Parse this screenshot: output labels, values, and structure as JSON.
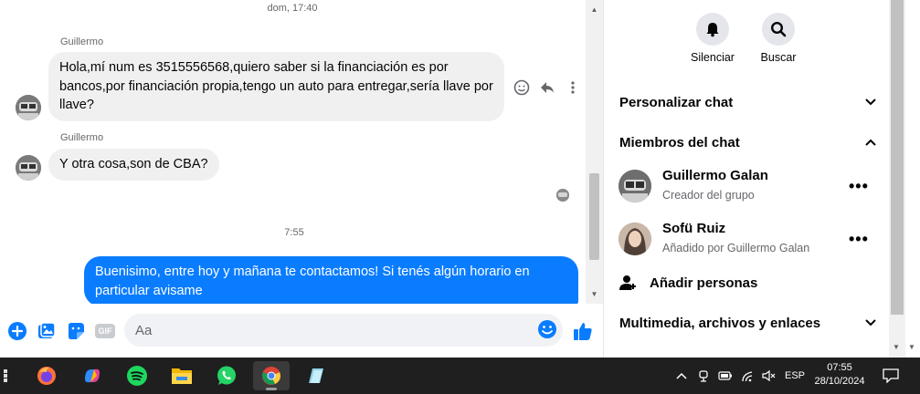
{
  "chat": {
    "timestamp_top": "dom, 17:40",
    "messages": [
      {
        "sender": "Guillermo",
        "text": "Hola,mí num es 3515556568,quiero saber si la financiación es por bancos,por financiación propia,tengo un auto para entregar,sería llave por llave?"
      },
      {
        "sender": "Guillermo",
        "text": "Y otra cosa,son de CBA?"
      }
    ],
    "timestamp_mid": "7:55",
    "outgoing": "Buenisimo, entre hoy y mañana te contactamos! Si tenés algún horario en particular avisame"
  },
  "composer": {
    "placeholder": "Aa",
    "gif_label": "GIF"
  },
  "info": {
    "mute_label": "Silenciar",
    "search_label": "Buscar",
    "sections": {
      "customize": "Personalizar chat",
      "members": "Miembros del chat",
      "media": "Multimedia, archivos y enlaces"
    },
    "members": [
      {
        "name": "Guillermo Galan",
        "role": "Creador del grupo"
      },
      {
        "name": "Sofü Ruiz",
        "role": "Añadido por Guillermo Galan"
      }
    ],
    "add_people": "Añadir personas"
  },
  "taskbar": {
    "language": "ESP",
    "time": "07:55",
    "date": "28/10/2024"
  },
  "colors": {
    "accent": "#0a7cff",
    "incoming_bubble": "#f0f0f0",
    "taskbar": "#1f1f1f"
  }
}
